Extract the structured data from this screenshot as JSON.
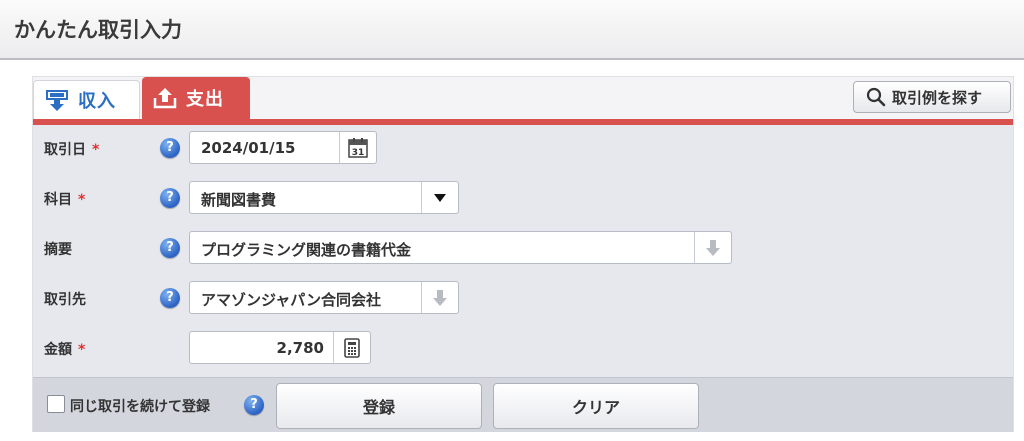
{
  "header": {
    "title": "かんたん取引入力"
  },
  "tabs": {
    "income": {
      "label": "収入",
      "icon": "income-download-icon",
      "color": "#2a6fc3"
    },
    "expense": {
      "label": "支出",
      "icon": "expense-upload-icon",
      "color": "#d9514f"
    }
  },
  "search_examples": {
    "label": "取引例を探す",
    "icon": "search-icon"
  },
  "form": {
    "date": {
      "label": "取引日",
      "required_mark": "*",
      "value": "2024/01/15",
      "icon": "calendar-icon",
      "calendar_day": "31"
    },
    "account": {
      "label": "科目",
      "required_mark": "*",
      "value": "新聞図書費",
      "icon": "chevron-down-icon"
    },
    "memo": {
      "label": "摘要",
      "value": "プログラミング関連の書籍代金",
      "icon": "arrow-down-icon"
    },
    "partner": {
      "label": "取引先",
      "value": "アマゾンジャパン合同会社",
      "icon": "arrow-down-icon"
    },
    "amount": {
      "label": "金額",
      "required_mark": "*",
      "value": "2,780",
      "icon": "calculator-icon"
    },
    "help_glyph": "?"
  },
  "footer": {
    "repeat_label": "同じ取引を続けて登録",
    "register_label": "登録",
    "clear_label": "クリア"
  },
  "colors": {
    "accent_red": "#d9514f",
    "income_blue": "#2a6fc3",
    "required_red": "#e03030",
    "help_blue": "#2c63c4"
  }
}
